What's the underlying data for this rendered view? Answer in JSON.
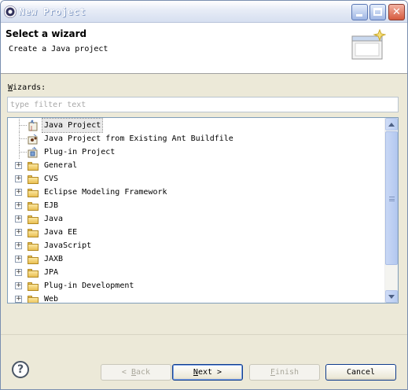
{
  "window": {
    "title": "New Project"
  },
  "header": {
    "title": "Select a wizard",
    "description": "Create a Java project"
  },
  "wizards": {
    "label_accel": "W",
    "label_rest": "izards:",
    "filter_placeholder": "type filter text",
    "items": [
      {
        "label": "Java Project",
        "icon": "java-project-icon",
        "kind": "leaf",
        "selected": true
      },
      {
        "label": "Java Project from Existing Ant Buildfile",
        "icon": "ant-project-icon",
        "kind": "leaf"
      },
      {
        "label": "Plug-in Project",
        "icon": "plugin-project-icon",
        "kind": "leaf"
      },
      {
        "label": "General",
        "icon": "folder-icon",
        "kind": "folder"
      },
      {
        "label": "CVS",
        "icon": "folder-icon",
        "kind": "folder"
      },
      {
        "label": "Eclipse Modeling Framework",
        "icon": "folder-icon",
        "kind": "folder"
      },
      {
        "label": "EJB",
        "icon": "folder-icon",
        "kind": "folder"
      },
      {
        "label": "Java",
        "icon": "folder-icon",
        "kind": "folder"
      },
      {
        "label": "Java EE",
        "icon": "folder-icon",
        "kind": "folder"
      },
      {
        "label": "JavaScript",
        "icon": "folder-icon",
        "kind": "folder"
      },
      {
        "label": "JAXB",
        "icon": "folder-icon",
        "kind": "folder"
      },
      {
        "label": "JPA",
        "icon": "folder-icon",
        "kind": "folder"
      },
      {
        "label": "Plug-in Development",
        "icon": "folder-icon",
        "kind": "folder"
      },
      {
        "label": "Web",
        "icon": "folder-icon",
        "kind": "folder"
      }
    ],
    "expander_symbol": "+"
  },
  "buttons": {
    "back": {
      "symbol": "<",
      "accel": "B",
      "rest": "ack"
    },
    "next": {
      "accel": "N",
      "rest": "ext",
      "symbol": ">"
    },
    "finish": {
      "accel": "F",
      "rest": "inish"
    },
    "cancel": {
      "label": "Cancel"
    },
    "help": {
      "symbol": "?"
    }
  }
}
